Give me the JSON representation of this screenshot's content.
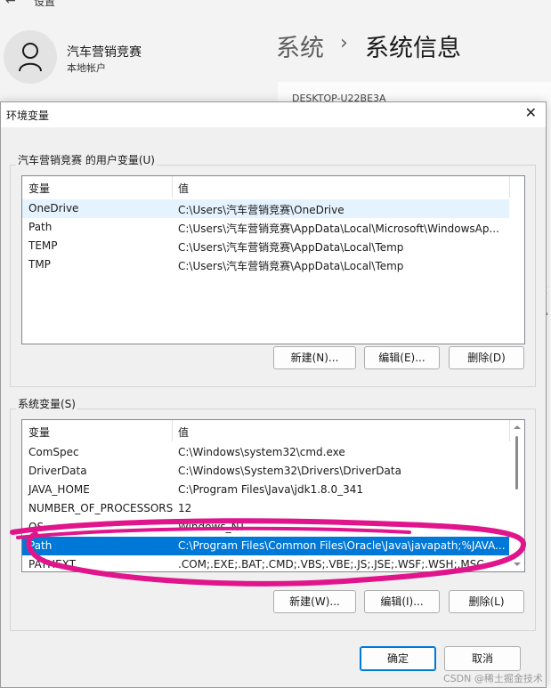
{
  "settings": {
    "title": "设置",
    "user_name": "汽车营销竞赛",
    "user_sub": "本地帐户",
    "breadcrumb_parent": "系统",
    "breadcrumb_sep": "›",
    "breadcrumb_current": "系统信息",
    "device_fragment": "DESKTOP-U22BE3A"
  },
  "dialog": {
    "title": "环境变量",
    "user_group_label": "汽车营销竞赛 的用户变量(U)",
    "system_group_label": "系统变量(S)",
    "col_name": "变量",
    "col_value": "值",
    "user_vars": [
      {
        "name": "OneDrive",
        "value": "C:\\Users\\汽车营销竞赛\\OneDrive"
      },
      {
        "name": "Path",
        "value": "C:\\Users\\汽车营销竞赛\\AppData\\Local\\Microsoft\\WindowsAp..."
      },
      {
        "name": "TEMP",
        "value": "C:\\Users\\汽车营销竞赛\\AppData\\Local\\Temp"
      },
      {
        "name": "TMP",
        "value": "C:\\Users\\汽车营销竞赛\\AppData\\Local\\Temp"
      }
    ],
    "system_vars": [
      {
        "name": "ComSpec",
        "value": "C:\\Windows\\system32\\cmd.exe"
      },
      {
        "name": "DriverData",
        "value": "C:\\Windows\\System32\\Drivers\\DriverData"
      },
      {
        "name": "JAVA_HOME",
        "value": "C:\\Program Files\\Java\\jdk1.8.0_341"
      },
      {
        "name": "NUMBER_OF_PROCESSORS",
        "value": "12"
      },
      {
        "name": "OS",
        "value": "Windows_NT"
      },
      {
        "name": "Path",
        "value": "C:\\Program Files\\Common Files\\Oracle\\Java\\javapath;%JAVA..."
      },
      {
        "name": "PATHEXT",
        "value": ".COM;.EXE;.BAT;.CMD;.VBS;.VBE;.JS;.JSE;.WSF;.WSH;.MSC"
      }
    ],
    "user_buttons": {
      "new": "新建(N)...",
      "edit": "编辑(E)...",
      "delete": "删除(D)"
    },
    "system_buttons": {
      "new": "新建(W)...",
      "edit": "编辑(I)...",
      "delete": "删除(L)"
    },
    "ok": "确定",
    "cancel": "取消"
  },
  "colors": {
    "selection": "#0078d7",
    "annotation": "#e0158c"
  },
  "icons": [
    "back-arrow-icon",
    "user-icon",
    "close-icon"
  ],
  "watermark": "CSDN @稀土掘金技术社区"
}
